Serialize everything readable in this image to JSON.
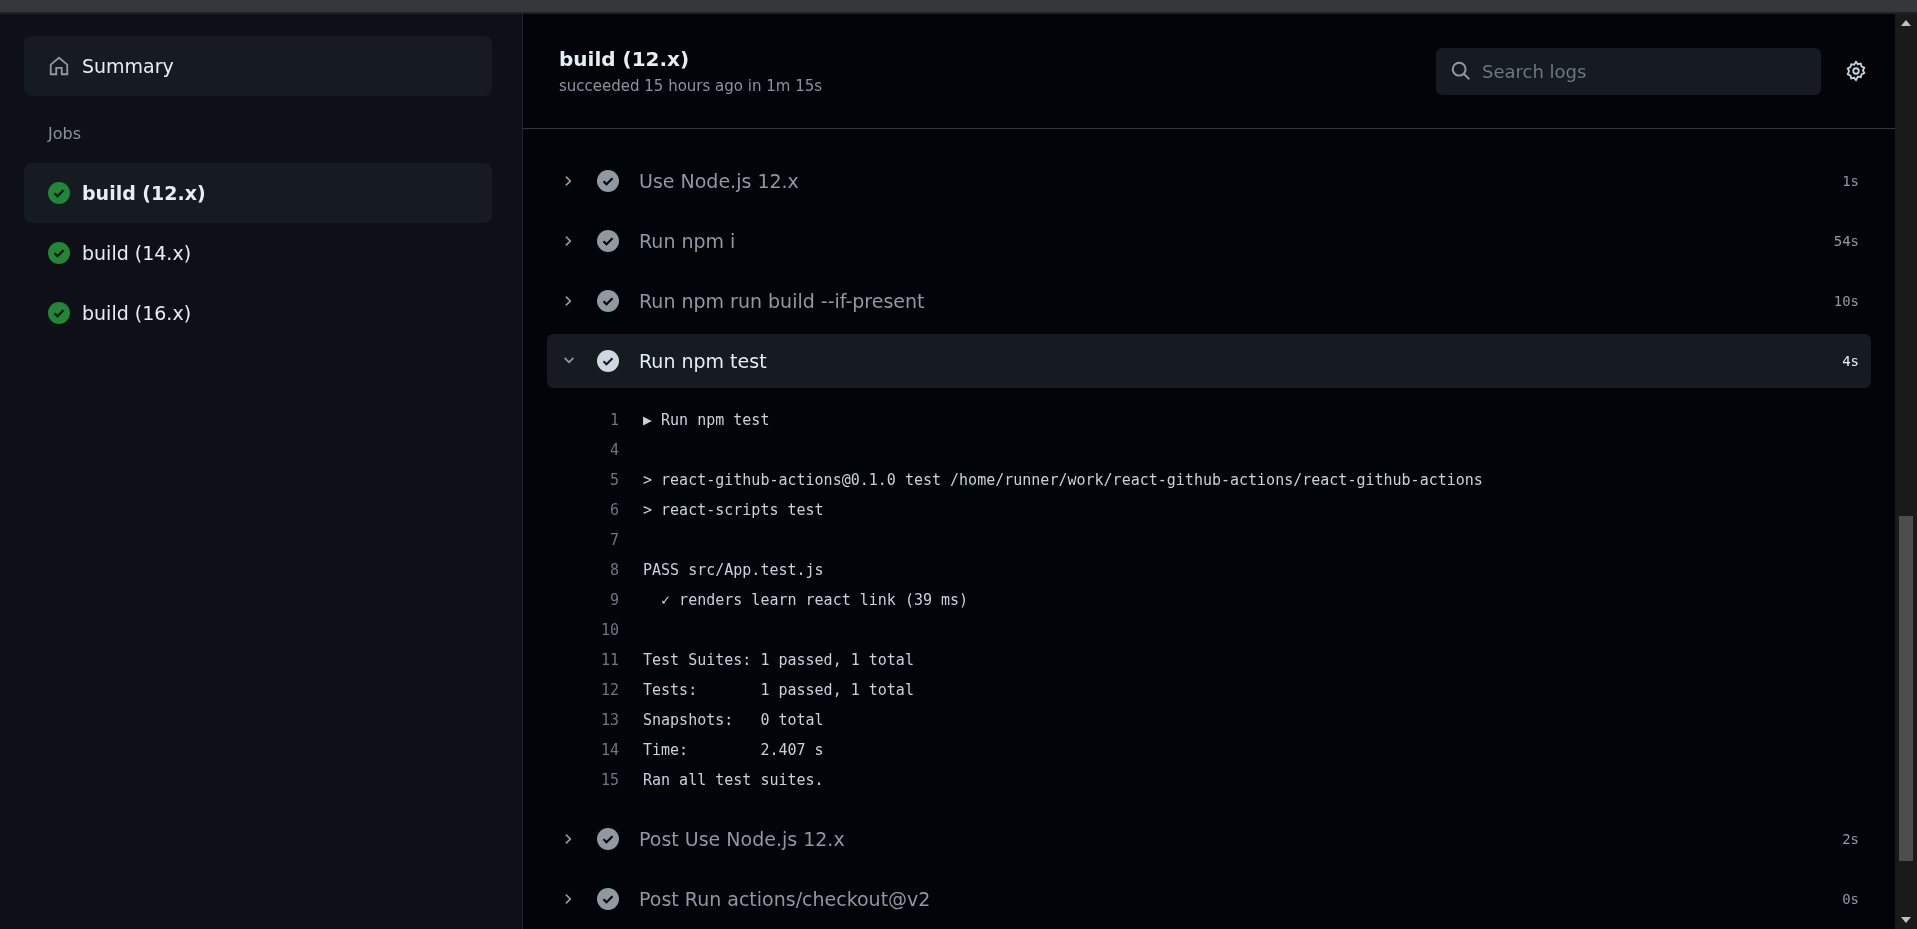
{
  "sidebar": {
    "summary": {
      "label": "Summary"
    },
    "jobs_heading": "Jobs",
    "jobs": [
      {
        "label": "build (12.x)",
        "selected": true
      },
      {
        "label": "build (14.x)",
        "selected": false
      },
      {
        "label": "build (16.x)",
        "selected": false
      }
    ]
  },
  "header": {
    "title": "build (12.x)",
    "subtitle": "succeeded 15 hours ago in 1m 15s",
    "search": {
      "placeholder": "Search logs"
    }
  },
  "steps": [
    {
      "name": "Use Node.js 12.x",
      "duration": "1s",
      "expanded": false
    },
    {
      "name": "Run npm i",
      "duration": "54s",
      "expanded": false
    },
    {
      "name": "Run npm run build --if-present",
      "duration": "10s",
      "expanded": false
    },
    {
      "name": "Run npm test",
      "duration": "4s",
      "expanded": true,
      "log": [
        {
          "number": "1",
          "text": "▶ Run npm test"
        },
        {
          "number": "4"
        },
        {
          "number": "5",
          "text": "> react-github-actions@0.1.0 test /home/runner/work/react-github-actions/react-github-actions"
        },
        {
          "number": "6",
          "text": "> react-scripts test"
        },
        {
          "number": "7"
        },
        {
          "number": "8",
          "text": "PASS src/App.test.js"
        },
        {
          "number": "9",
          "text": "  ✓ renders learn react link (39 ms)"
        },
        {
          "number": "10"
        },
        {
          "number": "11",
          "text": "Test Suites: 1 passed, 1 total"
        },
        {
          "number": "12",
          "text": "Tests:       1 passed, 1 total"
        },
        {
          "number": "13",
          "text": "Snapshots:   0 total"
        },
        {
          "number": "14",
          "text": "Time:        2.407 s"
        },
        {
          "number": "15",
          "text": "Ran all test suites."
        }
      ]
    },
    {
      "name": "Post Use Node.js 12.x",
      "duration": "2s",
      "expanded": false
    },
    {
      "name": "Post Run actions/checkout@v2",
      "duration": "0s",
      "expanded": false
    }
  ]
}
